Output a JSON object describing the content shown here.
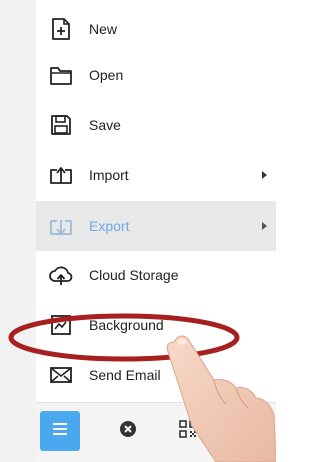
{
  "menu": {
    "items": [
      {
        "label": "New",
        "icon": "new-file-icon"
      },
      {
        "label": "Open",
        "icon": "folder-open-icon"
      },
      {
        "label": "Save",
        "icon": "save-icon"
      },
      {
        "label": "Import",
        "icon": "import-icon",
        "submenu": true
      },
      {
        "label": "Export",
        "icon": "export-icon",
        "submenu": true,
        "active": true
      },
      {
        "label": "Cloud Storage",
        "icon": "cloud-upload-icon"
      },
      {
        "label": "Background",
        "icon": "background-image-icon",
        "highlighted": true
      },
      {
        "label": "Send Email",
        "icon": "email-icon"
      }
    ]
  },
  "bottom_bar": {
    "buttons": [
      {
        "icon": "hamburger-menu-icon",
        "active": true
      },
      {
        "icon": "close-circle-icon"
      },
      {
        "icon": "qr-code-icon"
      }
    ]
  },
  "colors": {
    "accent": "#4aa8ef",
    "active_label": "#6ea9e4",
    "highlight_ellipse": "#a81f1f",
    "active_row_bg": "#e8e8e8"
  }
}
